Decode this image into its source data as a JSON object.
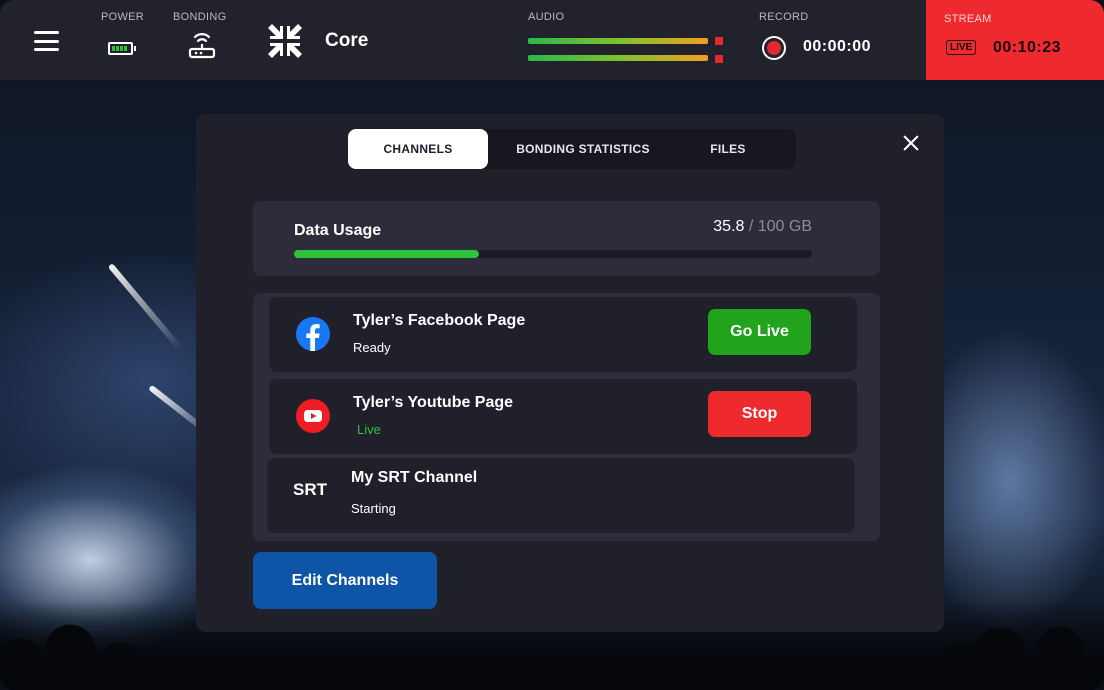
{
  "topbar": {
    "power_label": "POWER",
    "bonding_label": "BONDING",
    "core_label": "Core",
    "audio_label": "AUDIO",
    "record_label": "RECORD",
    "record_time": "00:00:00",
    "stream_label": "STREAM",
    "live_badge": "LIVE",
    "stream_time": "00:10:23",
    "icons": [
      "menu-icon",
      "battery-icon",
      "router-icon",
      "core-compress-icon",
      "record-icon"
    ]
  },
  "tabs": [
    {
      "label": "CHANNELS",
      "active": true
    },
    {
      "label": "BONDING STATISTICS",
      "active": false
    },
    {
      "label": "FILES",
      "active": false
    }
  ],
  "data_usage": {
    "title": "Data Usage",
    "used": "35.8",
    "total": " / 100 GB",
    "fraction": 0.358
  },
  "channels": [
    {
      "icon": "facebook-icon",
      "name": "Tyler’s Facebook Page",
      "status": "Ready",
      "action": "Go Live"
    },
    {
      "icon": "youtube-icon",
      "name": "Tyler’s Youtube Page",
      "status": "Live",
      "action": "Stop"
    },
    {
      "icon": "srt-icon",
      "icon_text": "SRT",
      "name": "My SRT Channel",
      "status": "Starting"
    }
  ],
  "edit_button": "Edit Channels",
  "colors": {
    "accent_green": "#2ec23c",
    "stream_red": "#ee2a2f",
    "edit_blue": "#0e55a8"
  }
}
